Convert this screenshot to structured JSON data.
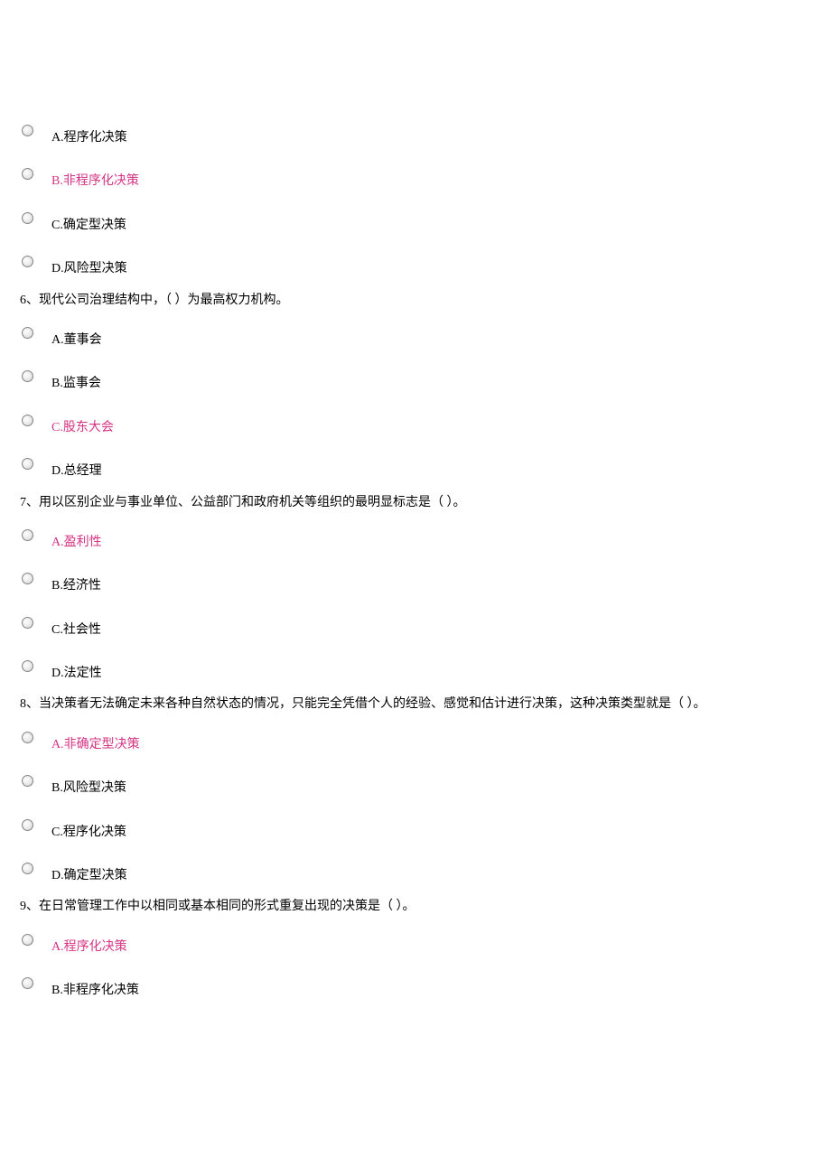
{
  "questions": [
    {
      "text": "",
      "options": [
        {
          "label": "A.程序化决策",
          "highlighted": false
        },
        {
          "label": "B.非程序化决策",
          "highlighted": true
        },
        {
          "label": "C.确定型决策",
          "highlighted": false
        },
        {
          "label": "D.风险型决策",
          "highlighted": false
        }
      ]
    },
    {
      "text": "6、现代公司治理结构中，（  ）为最高权力机构。",
      "options": [
        {
          "label": "A.董事会",
          "highlighted": false
        },
        {
          "label": "B.监事会",
          "highlighted": false
        },
        {
          "label": "C.股东大会",
          "highlighted": true
        },
        {
          "label": "D.总经理",
          "highlighted": false
        }
      ]
    },
    {
      "text": "7、用以区别企业与事业单位、公益部门和政府机关等组织的最明显标志是（ ）。",
      "options": [
        {
          "label": "A.盈利性",
          "highlighted": true
        },
        {
          "label": "B.经济性",
          "highlighted": false
        },
        {
          "label": "C.社会性",
          "highlighted": false
        },
        {
          "label": "D.法定性",
          "highlighted": false
        }
      ]
    },
    {
      "text": "8、当决策者无法确定未来各种自然状态的情况，只能完全凭借个人的经验、感觉和估计进行决策，这种决策类型就是（ ）。",
      "options": [
        {
          "label": "A.非确定型决策",
          "highlighted": true
        },
        {
          "label": "B.风险型决策",
          "highlighted": false
        },
        {
          "label": "C.程序化决策",
          "highlighted": false
        },
        {
          "label": "D.确定型决策",
          "highlighted": false
        }
      ]
    },
    {
      "text": "9、在日常管理工作中以相同或基本相同的形式重复出现的决策是（ ）。",
      "options": [
        {
          "label": "A.程序化决策",
          "highlighted": true
        },
        {
          "label": "B.非程序化决策",
          "highlighted": false
        }
      ]
    }
  ]
}
